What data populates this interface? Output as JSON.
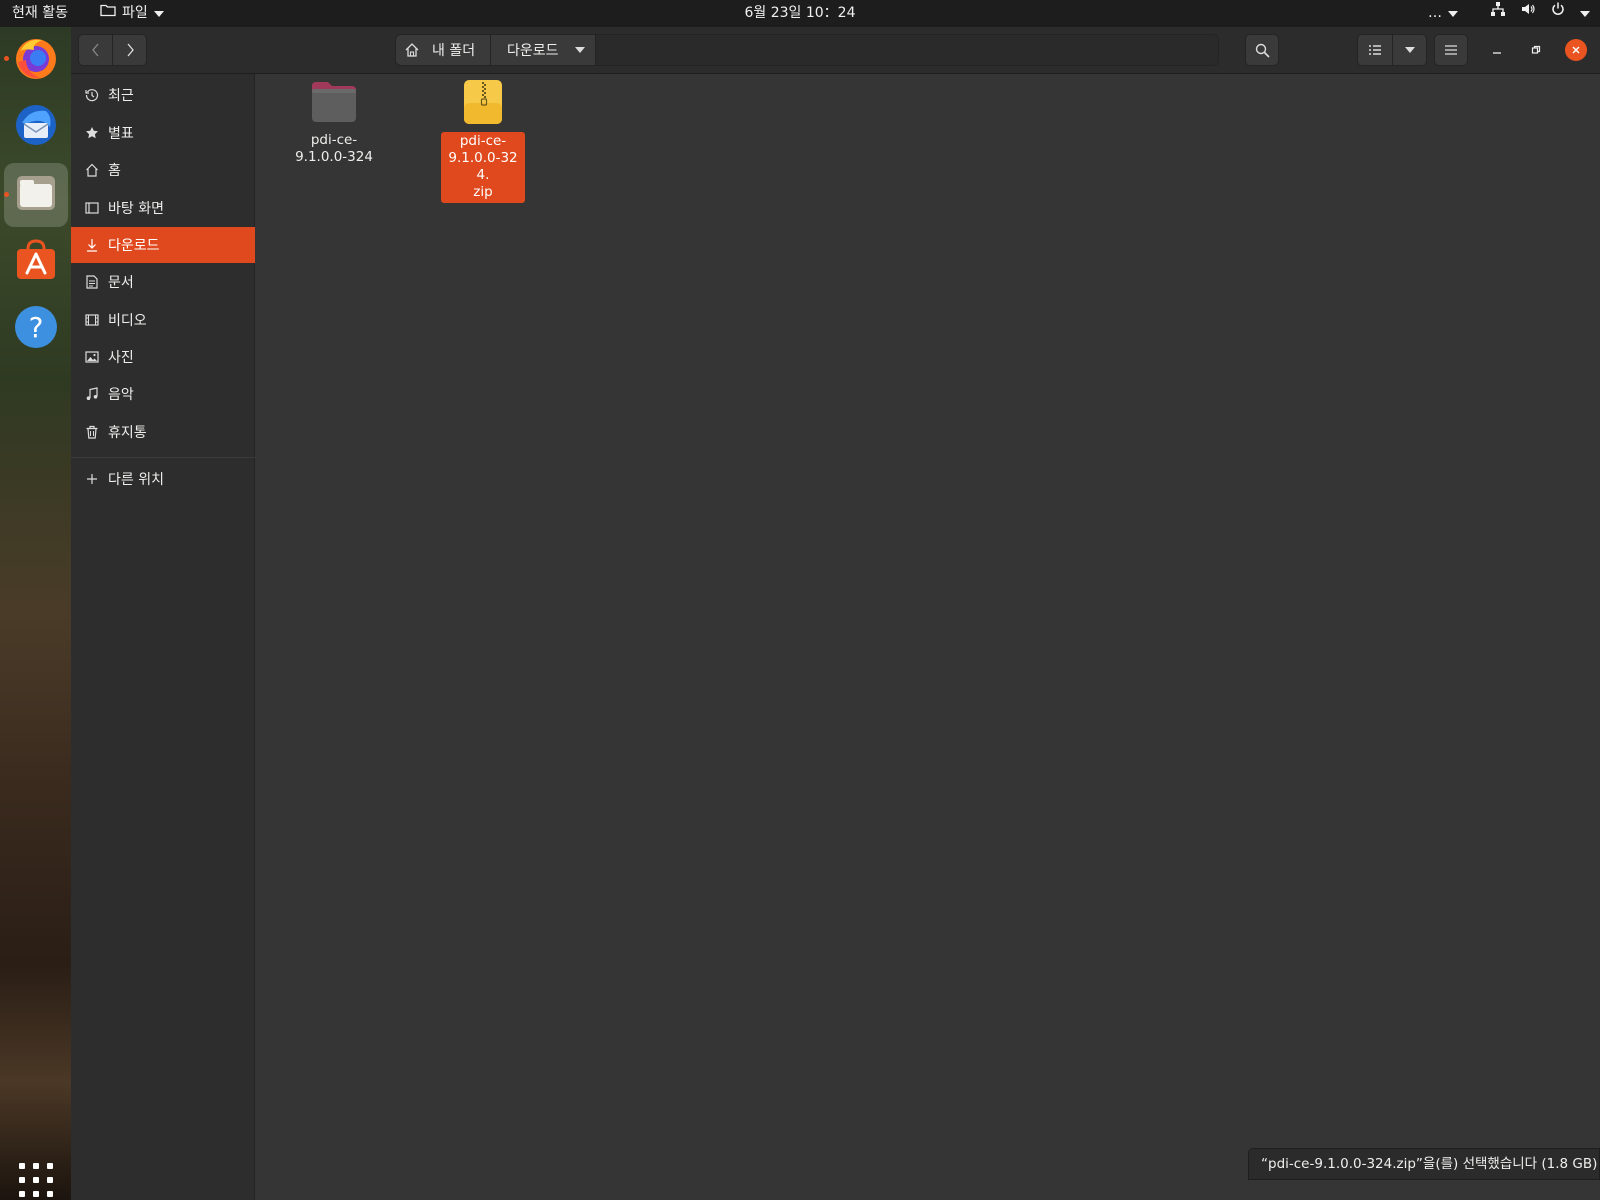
{
  "topbar": {
    "activities": "현재 활동",
    "app_menu": {
      "label": "파일",
      "icon": "folder-icon"
    },
    "clock": "6월 23일  10：24",
    "overflow": "…",
    "tray_icons": [
      "network-icon",
      "volume-icon",
      "power-icon"
    ]
  },
  "dock": {
    "apps": [
      {
        "name": "Firefox",
        "icon": "firefox-icon",
        "running": true,
        "active": false
      },
      {
        "name": "Thunderbird",
        "icon": "thunderbird-icon",
        "running": false,
        "active": false
      },
      {
        "name": "Files",
        "icon": "files-icon",
        "running": true,
        "active": true
      },
      {
        "name": "Ubuntu Software",
        "icon": "software-icon",
        "running": false,
        "active": false
      },
      {
        "name": "Help",
        "icon": "help-icon",
        "running": false,
        "active": false
      }
    ],
    "show_apps_icon": "app-grid-icon"
  },
  "headerbar": {
    "path": [
      {
        "label": "내 폴더",
        "icon": "home-icon"
      },
      {
        "label": "다운로드",
        "icon": "chevron-down-icon"
      }
    ]
  },
  "sidebar": {
    "items": [
      {
        "label": "최근",
        "icon": "recent-icon",
        "selected": false
      },
      {
        "label": "별표",
        "icon": "star-icon",
        "selected": false
      },
      {
        "label": "홈",
        "icon": "home-icon",
        "selected": false
      },
      {
        "label": "바탕 화면",
        "icon": "desktop-icon",
        "selected": false
      },
      {
        "label": "다운로드",
        "icon": "download-icon",
        "selected": true
      },
      {
        "label": "문서",
        "icon": "document-icon",
        "selected": false
      },
      {
        "label": "비디오",
        "icon": "video-icon",
        "selected": false
      },
      {
        "label": "사진",
        "icon": "picture-icon",
        "selected": false
      },
      {
        "label": "음악",
        "icon": "music-icon",
        "selected": false
      },
      {
        "label": "휴지통",
        "icon": "trash-icon",
        "selected": false
      }
    ],
    "other_locations": {
      "label": "다른 위치",
      "icon": "plus-icon"
    }
  },
  "files": [
    {
      "name": "pdi-ce-9.1.0.0-324",
      "display_lines": [
        "pdi-ce-",
        "9.1.0.0-324"
      ],
      "icon": "folder-icon",
      "selected": false
    },
    {
      "name": "pdi-ce-9.1.0.0-324.zip",
      "display_lines": [
        "pdi-ce-",
        "9.1.0.0-324.",
        "zip"
      ],
      "icon": "zip-archive-icon",
      "selected": true
    }
  ],
  "status": "“pdi-ce-9.1.0.0-324.zip”을(를) 선택했습니다  (1.8 GB)",
  "colors": {
    "accent": "#e0481d",
    "close_button": "#e95420",
    "window_bg": "#353535",
    "sidebar_bg": "#2d2d2d",
    "headerbar_bg": "#2c2c2c"
  }
}
